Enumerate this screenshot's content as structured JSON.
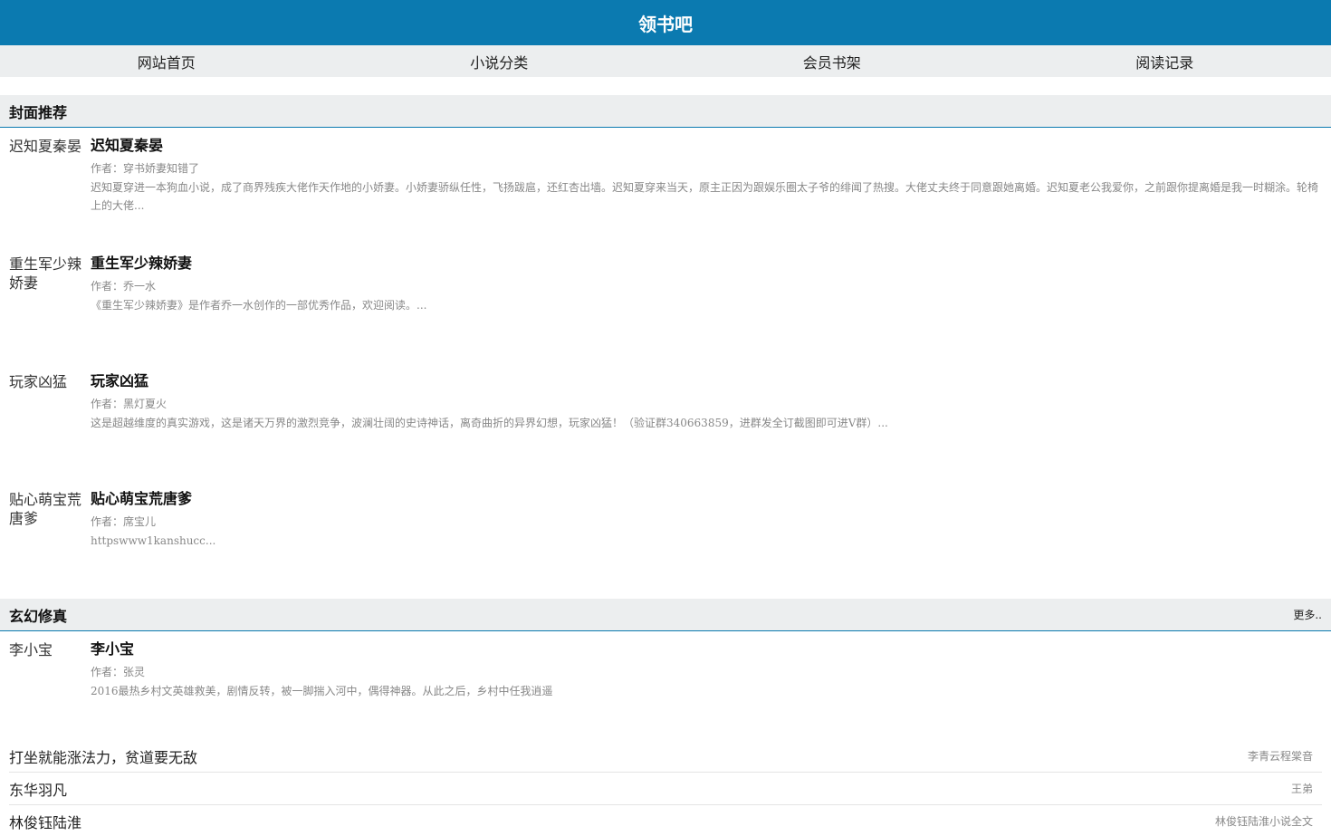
{
  "header": {
    "title": "领书吧"
  },
  "nav": [
    {
      "label": "网站首页"
    },
    {
      "label": "小说分类"
    },
    {
      "label": "会员书架"
    },
    {
      "label": "阅读记录"
    }
  ],
  "cover_section": {
    "title": "封面推荐",
    "books": [
      {
        "cover_alt": "迟知夏秦晏",
        "title": "迟知夏秦晏",
        "author": "作者：穿书娇妻知错了",
        "desc": "迟知夏穿进一本狗血小说，成了商界残疾大佬作天作地的小娇妻。小娇妻骄纵任性，飞扬跋扈，还红杏出墙。迟知夏穿来当天，原主正因为跟娱乐圈太子爷的绯闻了热搜。大佬丈夫终于同意跟她离婚。迟知夏老公我爱你，之前跟你提离婚是我一时糊涂。轮椅上的大佬..."
      },
      {
        "cover_alt": "重生军少辣娇妻",
        "title": "重生军少辣娇妻",
        "author": "作者：乔一水",
        "desc": "《重生军少辣娇妻》是作者乔一水创作的一部优秀作品，欢迎阅读。..."
      },
      {
        "cover_alt": "玩家凶猛",
        "title": "玩家凶猛",
        "author": "作者：黑灯夏火",
        "desc": "这是超越维度的真实游戏，这是诸天万界的激烈竞争，波澜壮阔的史诗神话，离奇曲折的异界幻想，玩家凶猛！（验证群340663859，进群发全订截图即可进V群）..."
      },
      {
        "cover_alt": "贴心萌宝荒唐爹",
        "title": "贴心萌宝荒唐爹",
        "author": "作者：席宝儿",
        "desc": "httpswww1kanshucc..."
      }
    ]
  },
  "fantasy_section": {
    "title": "玄幻修真",
    "more": "更多..",
    "books": [
      {
        "cover_alt": "李小宝",
        "title": "李小宝",
        "author": "作者：张灵",
        "desc": "2016最热乡村文英雄救美，剧情反转，被一脚揣入河中，偶得神器。从此之后，乡村中任我逍遥"
      }
    ],
    "list": [
      {
        "title": "打坐就能涨法力，贫道要无敌",
        "author": "李青云程棠音"
      },
      {
        "title": "东华羽凡",
        "author": "王弟"
      },
      {
        "title": "林俊钰陆淮",
        "author": "林俊钰陆淮小说全文"
      }
    ]
  }
}
